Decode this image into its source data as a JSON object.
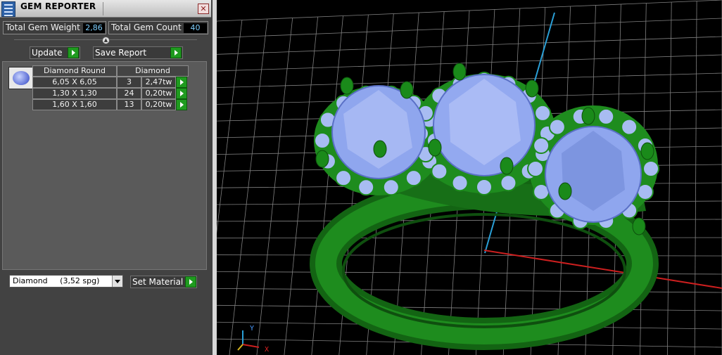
{
  "panel": {
    "title": "GEM REPORTER",
    "close_glyph": "✕",
    "total_weight_label": "Total Gem Weight",
    "total_weight_value": "2,86",
    "total_count_label": "Total Gem Count",
    "total_count_value": "40",
    "collapse_glyph": "▲",
    "update_label": "Update",
    "save_report_label": "Save Report",
    "table": {
      "header_shape": "Diamond Round",
      "header_material": "Diamond",
      "rows": [
        {
          "size": "6,05 X 6,05",
          "count": "3",
          "weight": "2,47tw"
        },
        {
          "size": "1,30 X 1,30",
          "count": "24",
          "weight": "0,20tw"
        },
        {
          "size": "1,60 X 1,60",
          "count": "13",
          "weight": "0,20tw"
        }
      ]
    },
    "material_select_value": "Diamond     (3,52 spg)",
    "set_material_label": "Set Material"
  },
  "viewport": {
    "axis_y_label": "Y",
    "axis_x_label": "X",
    "colors": {
      "background": "#000000",
      "grid": "#808080",
      "metal": "#1e8c1e",
      "gem": "#8fa6ee",
      "axis_x": "#cc1f1f",
      "axis_y": "#2a9fd6"
    }
  }
}
